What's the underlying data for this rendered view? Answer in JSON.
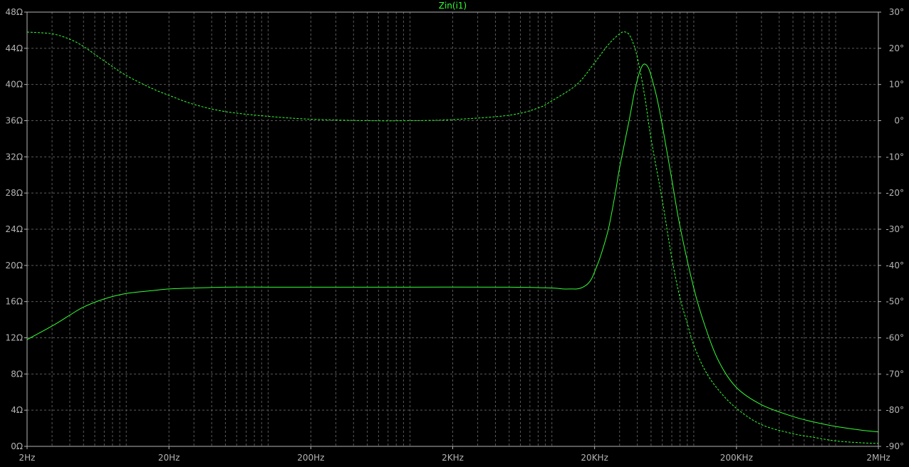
{
  "chart_data": {
    "type": "line",
    "title": "Zin(i1)",
    "x_scale": "log",
    "xlim": [
      2,
      2000000
    ],
    "ylim_left": [
      0,
      48
    ],
    "ylim_right": [
      -90,
      30
    ],
    "grid": true,
    "x_tick_labels": [
      {
        "value": 2,
        "label": "2Hz"
      },
      {
        "value": 20,
        "label": "20Hz"
      },
      {
        "value": 200,
        "label": "200Hz"
      },
      {
        "value": 2000,
        "label": "2KHz"
      },
      {
        "value": 20000,
        "label": "20KHz"
      },
      {
        "value": 200000,
        "label": "200KHz"
      },
      {
        "value": 2000000,
        "label": "2MHz"
      }
    ],
    "y_left_tick_labels": [
      {
        "value": 48,
        "label": "48Ω"
      },
      {
        "value": 44,
        "label": "44Ω"
      },
      {
        "value": 40,
        "label": "40Ω"
      },
      {
        "value": 36,
        "label": "36Ω"
      },
      {
        "value": 32,
        "label": "32Ω"
      },
      {
        "value": 28,
        "label": "28Ω"
      },
      {
        "value": 24,
        "label": "24Ω"
      },
      {
        "value": 20,
        "label": "20Ω"
      },
      {
        "value": 16,
        "label": "16Ω"
      },
      {
        "value": 12,
        "label": "12Ω"
      },
      {
        "value": 8,
        "label": "8Ω"
      },
      {
        "value": 4,
        "label": "4Ω"
      },
      {
        "value": 0,
        "label": "0Ω"
      }
    ],
    "y_right_tick_labels": [
      {
        "value": 30,
        "label": "30°"
      },
      {
        "value": 20,
        "label": "20°"
      },
      {
        "value": 10,
        "label": "10°"
      },
      {
        "value": 0,
        "label": "0°"
      },
      {
        "value": -10,
        "label": "-10°"
      },
      {
        "value": -20,
        "label": "-20°"
      },
      {
        "value": -30,
        "label": "-30°"
      },
      {
        "value": -40,
        "label": "-40°"
      },
      {
        "value": -50,
        "label": "-50°"
      },
      {
        "value": -60,
        "label": "-60°"
      },
      {
        "value": -70,
        "label": "-70°"
      },
      {
        "value": -80,
        "label": "-80°"
      },
      {
        "value": -90,
        "label": "-90°"
      }
    ],
    "series": [
      {
        "axis": "left",
        "style": "solid",
        "color": "#33ff33",
        "x": [
          2,
          3,
          4,
          5,
          7,
          10,
          15,
          20,
          30,
          50,
          100,
          200,
          1000,
          5000,
          10000,
          12000,
          14000,
          15000,
          16000,
          17000,
          18000,
          19000,
          20000,
          22000,
          25000,
          28000,
          30000,
          35000,
          38000,
          40000,
          42000,
          44000,
          46000,
          48000,
          50000,
          55000,
          60000,
          70000,
          80000,
          100000,
          120000,
          150000,
          200000,
          300000,
          500000,
          700000,
          1000000,
          1500000,
          2000000
        ],
        "y": [
          11.8,
          13.3,
          14.5,
          15.4,
          16.3,
          16.9,
          17.2,
          17.4,
          17.5,
          17.6,
          17.6,
          17.6,
          17.6,
          17.6,
          17.5,
          17.4,
          17.4,
          17.4,
          17.5,
          17.7,
          18.0,
          18.5,
          19.3,
          21.0,
          24.0,
          28.0,
          30.8,
          36.0,
          39.0,
          40.5,
          41.6,
          42.2,
          42.2,
          41.8,
          41.0,
          38.5,
          35.5,
          29.5,
          24.3,
          17.5,
          13.3,
          9.4,
          6.5,
          4.6,
          3.3,
          2.7,
          2.2,
          1.8,
          1.6
        ]
      },
      {
        "axis": "right",
        "style": "dashed",
        "color": "#33ff33",
        "x": [
          2,
          3,
          4,
          5,
          7,
          10,
          15,
          20,
          30,
          50,
          100,
          200,
          500,
          1000,
          2000,
          5000,
          8000,
          10000,
          15000,
          20000,
          25000,
          30000,
          33000,
          36000,
          40000,
          45000,
          50000,
          60000,
          70000,
          80000,
          90000,
          100000,
          120000,
          150000,
          200000,
          300000,
          500000,
          700000,
          1000000,
          1500000,
          2000000
        ],
        "y": [
          24.5,
          24,
          22.5,
          20.5,
          16.5,
          12.5,
          9,
          7,
          4.5,
          2.5,
          1.2,
          0.4,
          0,
          0,
          0.3,
          1.5,
          3.5,
          5.5,
          10,
          16,
          21,
          24,
          24.5,
          23,
          17.5,
          7,
          -5,
          -22,
          -38,
          -49,
          -56,
          -62,
          -69,
          -74.5,
          -79.5,
          -84,
          -86.5,
          -87.5,
          -88.5,
          -89,
          -89.2
        ]
      }
    ]
  }
}
